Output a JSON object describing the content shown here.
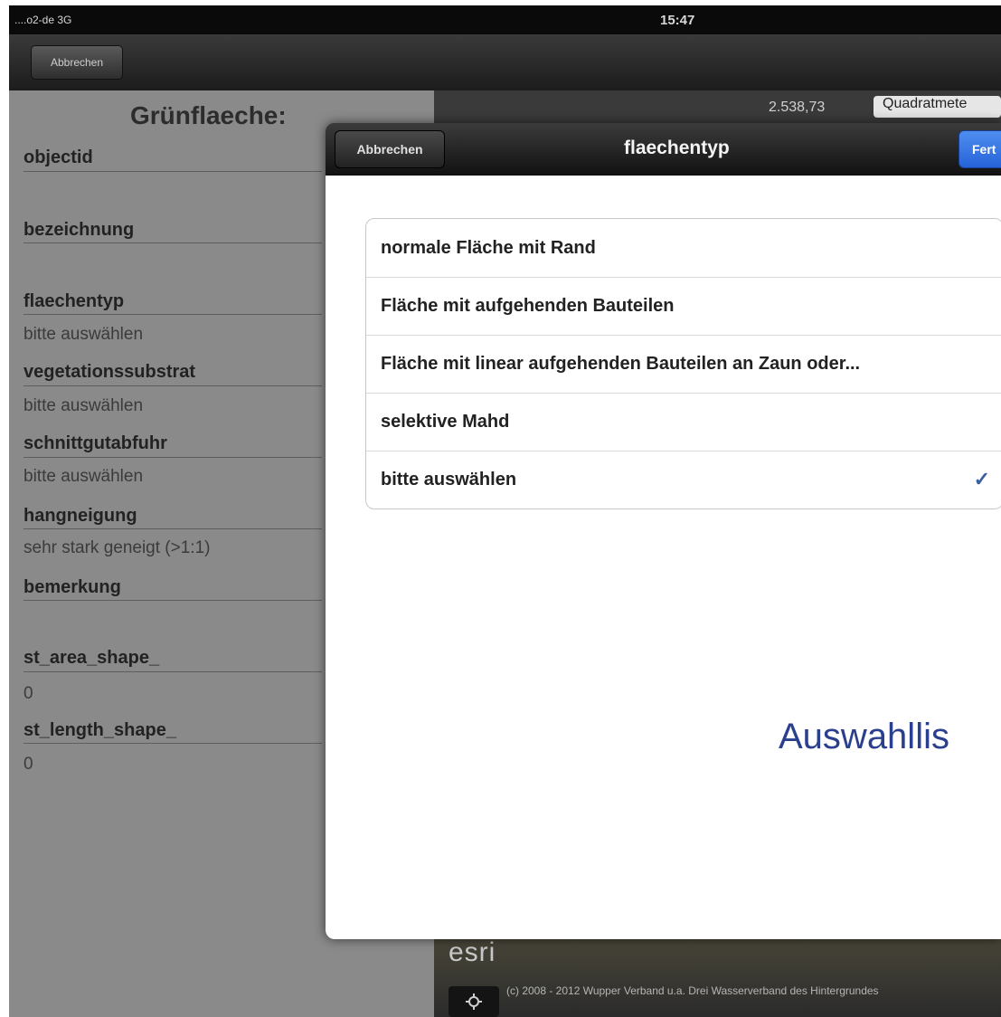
{
  "status_bar": {
    "carrier": "....o2-de 3G",
    "time": "15:47"
  },
  "top_nav": {
    "cancel_label": "Abbrechen"
  },
  "form": {
    "title": "Grünflaeche:",
    "fields": [
      {
        "label": "objectid",
        "value": ""
      },
      {
        "label": "bezeichnung",
        "value": ""
      },
      {
        "label": "flaechentyp",
        "value": "bitte auswählen"
      },
      {
        "label": "vegetationssubstrat",
        "value": "bitte auswählen"
      },
      {
        "label": "schnittgutabfuhr",
        "value": "bitte auswählen"
      },
      {
        "label": "hangneigung",
        "value": "sehr stark geneigt (>1:1)"
      },
      {
        "label": "bemerkung",
        "value": ""
      },
      {
        "label": "st_area_shape_",
        "value": "0"
      },
      {
        "label": "st_length_shape_",
        "value": "0"
      }
    ]
  },
  "map": {
    "measure_value": "2.538,73",
    "unit_label": "Quadratmete",
    "logo": "esri",
    "attribution": "(c) 2008 - 2012 Wupper Verband u.a. Drei Wasserverband des Hintergrundes",
    "tool_icon": "gps-icon"
  },
  "popover": {
    "cancel_label": "Abbrechen",
    "title": "flaechentyp",
    "done_label": "Fert",
    "options": [
      {
        "label": "normale Fläche mit Rand",
        "selected": false
      },
      {
        "label": "Fläche mit aufgehenden Bauteilen",
        "selected": false
      },
      {
        "label": "Fläche mit linear aufgehenden Bauteilen an Zaun oder...",
        "selected": false
      },
      {
        "label": "selektive Mahd",
        "selected": false
      },
      {
        "label": "bitte auswählen",
        "selected": true
      }
    ],
    "checkmark": "✓"
  },
  "overlay_caption": "Auswahllis"
}
